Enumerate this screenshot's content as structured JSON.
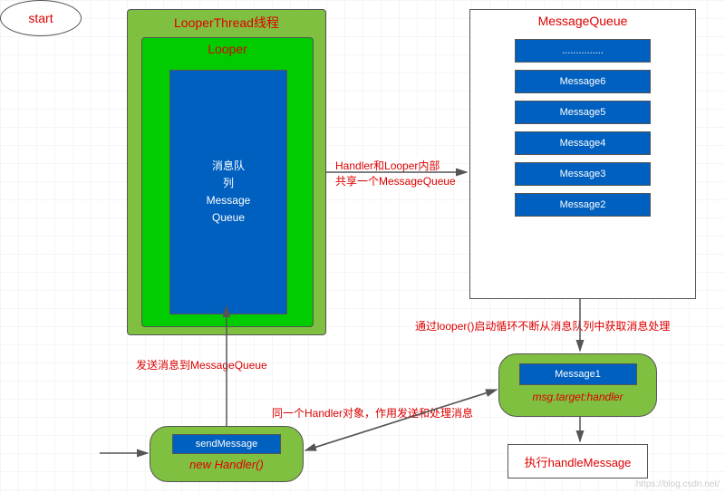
{
  "looperThread": {
    "title": "LooperThread线程"
  },
  "looper": {
    "title": "Looper"
  },
  "innerQueue": {
    "line1": "消息队",
    "line2": "列",
    "line3": "Message",
    "line4": "Queue"
  },
  "messageQueue": {
    "title": "MessageQueue",
    "items": [
      "...............",
      "Message6",
      "Message5",
      "Message4",
      "Message3",
      "Message2"
    ]
  },
  "handlerBox": {
    "msg": "Message1",
    "label": "msg.target:handler"
  },
  "execBox": {
    "label": "执行handleMessage"
  },
  "newHandler": {
    "send": "sendMessage",
    "label": "new Handler()"
  },
  "start": {
    "label": "start"
  },
  "annotations": {
    "a1": "发送消息到MessageQueue",
    "a2_l1": "Handler和Looper内部",
    "a2_l2": "共享一个MessageQueue",
    "a3": "通过looper()启动循环不断从消息队列中获取消息处理",
    "a4": "同一个Handler对象，作用发送和处理消息"
  },
  "watermark": "https://blog.csdn.net/"
}
